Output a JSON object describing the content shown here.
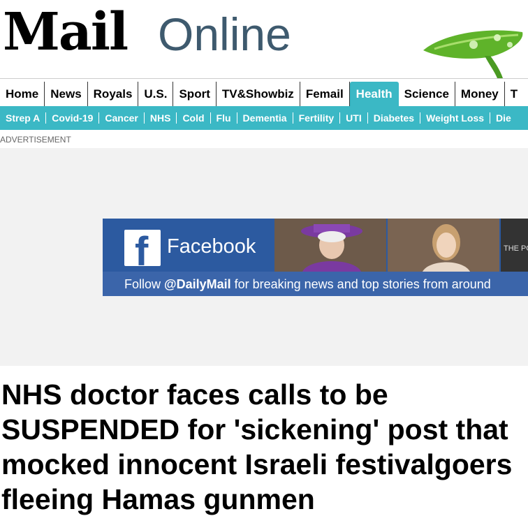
{
  "masthead": {
    "logo_mail": "Mail",
    "logo_online": "Online"
  },
  "nav_primary": {
    "items": [
      {
        "label": "Home"
      },
      {
        "label": "News"
      },
      {
        "label": "Royals"
      },
      {
        "label": "U.S."
      },
      {
        "label": "Sport"
      },
      {
        "label": "TV&Showbiz"
      },
      {
        "label": "Femail"
      },
      {
        "label": "Health",
        "active": true
      },
      {
        "label": "Science"
      },
      {
        "label": "Money"
      },
      {
        "label": "T"
      }
    ]
  },
  "nav_secondary": {
    "items": [
      {
        "label": "Strep A"
      },
      {
        "label": "Covid-19"
      },
      {
        "label": "Cancer"
      },
      {
        "label": "NHS"
      },
      {
        "label": "Cold"
      },
      {
        "label": "Flu"
      },
      {
        "label": "Dementia"
      },
      {
        "label": "Fertility"
      },
      {
        "label": "UTI"
      },
      {
        "label": "Diabetes"
      },
      {
        "label": "Weight Loss"
      },
      {
        "label": "Die"
      }
    ]
  },
  "advert_label": "ADVERTISEMENT",
  "facebook_banner": {
    "logo_letter": "f",
    "brand": "Facebook",
    "follow_prefix": "Follow ",
    "follow_handle": "@DailyMail",
    "follow_suffix": " for breaking news and top stories from around",
    "photo3_text": "THE POST"
  },
  "article": {
    "headline_lines": [
      "NHS doctor faces calls to be",
      "SUSPENDED for 'sickening' post that",
      "mocked innocent Israeli festivalgoers",
      "fleeing Hamas gunmen"
    ]
  },
  "colors": {
    "accent": "#3bb8c5",
    "facebook_blue": "#2c5aa0",
    "logo_online": "#3e5a6e"
  }
}
